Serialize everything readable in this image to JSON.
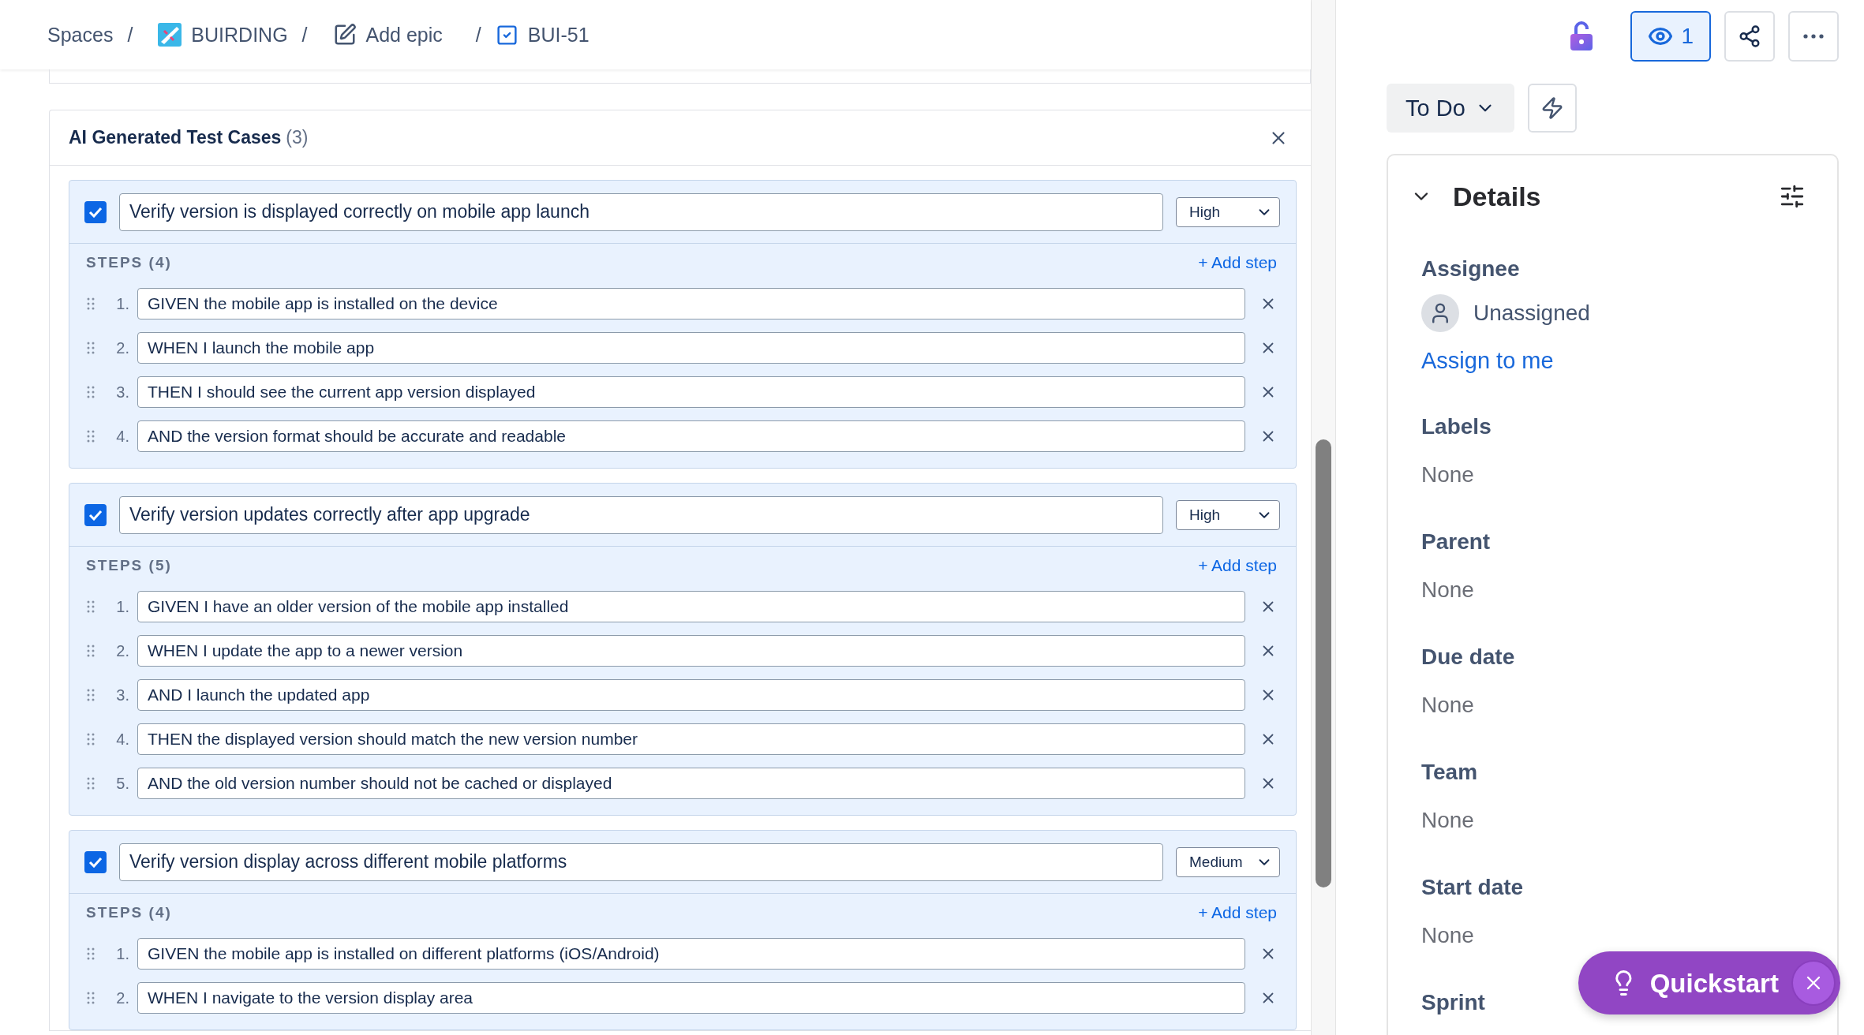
{
  "breadcrumbs": [
    {
      "label": "Spaces",
      "kind": "text",
      "separator": "/"
    },
    {
      "label": "BUIRDING",
      "kind": "space",
      "separator": "/"
    },
    {
      "label": "Add epic",
      "kind": "epic",
      "separator": "/"
    },
    {
      "label": "BUI-51",
      "kind": "task"
    }
  ],
  "test_cases": {
    "title": "AI Generated Test Cases",
    "count": "(3)",
    "cases": [
      {
        "checked": true,
        "title": "Verify version is displayed correctly on mobile app launch",
        "priority": "High",
        "steps_label": "STEPS (4)",
        "add_step": "+ Add step",
        "steps": [
          {
            "number": "1.",
            "text": "GIVEN the mobile app is installed on the device"
          },
          {
            "number": "2.",
            "text": "WHEN I launch the mobile app"
          },
          {
            "number": "3.",
            "text": "THEN I should see the current app version displayed"
          },
          {
            "number": "4.",
            "text": "AND the version format should be accurate and readable"
          }
        ]
      },
      {
        "checked": true,
        "title": "Verify version updates correctly after app upgrade",
        "priority": "High",
        "steps_label": "STEPS (5)",
        "add_step": "+ Add step",
        "steps": [
          {
            "number": "1.",
            "text": "GIVEN I have an older version of the mobile app installed"
          },
          {
            "number": "2.",
            "text": "WHEN I update the app to a newer version"
          },
          {
            "number": "3.",
            "text": "AND I launch the updated app"
          },
          {
            "number": "4.",
            "text": "THEN the displayed version should match the new version number"
          },
          {
            "number": "5.",
            "text": "AND the old version number should not be cached or displayed"
          }
        ]
      },
      {
        "checked": true,
        "title": "Verify version display across different mobile platforms",
        "priority": "Medium",
        "steps_label": "STEPS (4)",
        "add_step": "+ Add step",
        "steps": [
          {
            "number": "1.",
            "text": "GIVEN the mobile app is installed on different platforms (iOS/Android)"
          },
          {
            "number": "2.",
            "text": "WHEN I navigate to the version display area"
          }
        ]
      }
    ]
  },
  "header_actions": {
    "watchers": {
      "count": "1",
      "selected": true
    }
  },
  "status": {
    "label": "To Do"
  },
  "details": {
    "title": "Details",
    "expanded": true,
    "fields": [
      {
        "kind": "person",
        "label": "Assignee",
        "value": "Unassigned",
        "link": "Assign to me"
      },
      {
        "kind": "plain",
        "label": "Labels",
        "value": "None"
      },
      {
        "kind": "plain",
        "label": "Parent",
        "value": "None"
      },
      {
        "kind": "plain",
        "label": "Due date",
        "value": "None"
      },
      {
        "kind": "plain",
        "label": "Team",
        "value": "None"
      },
      {
        "kind": "plain",
        "label": "Start date",
        "value": "None"
      },
      {
        "kind": "label_only",
        "label": "Sprint"
      }
    ]
  },
  "quickstart": {
    "label": "Quickstart"
  }
}
